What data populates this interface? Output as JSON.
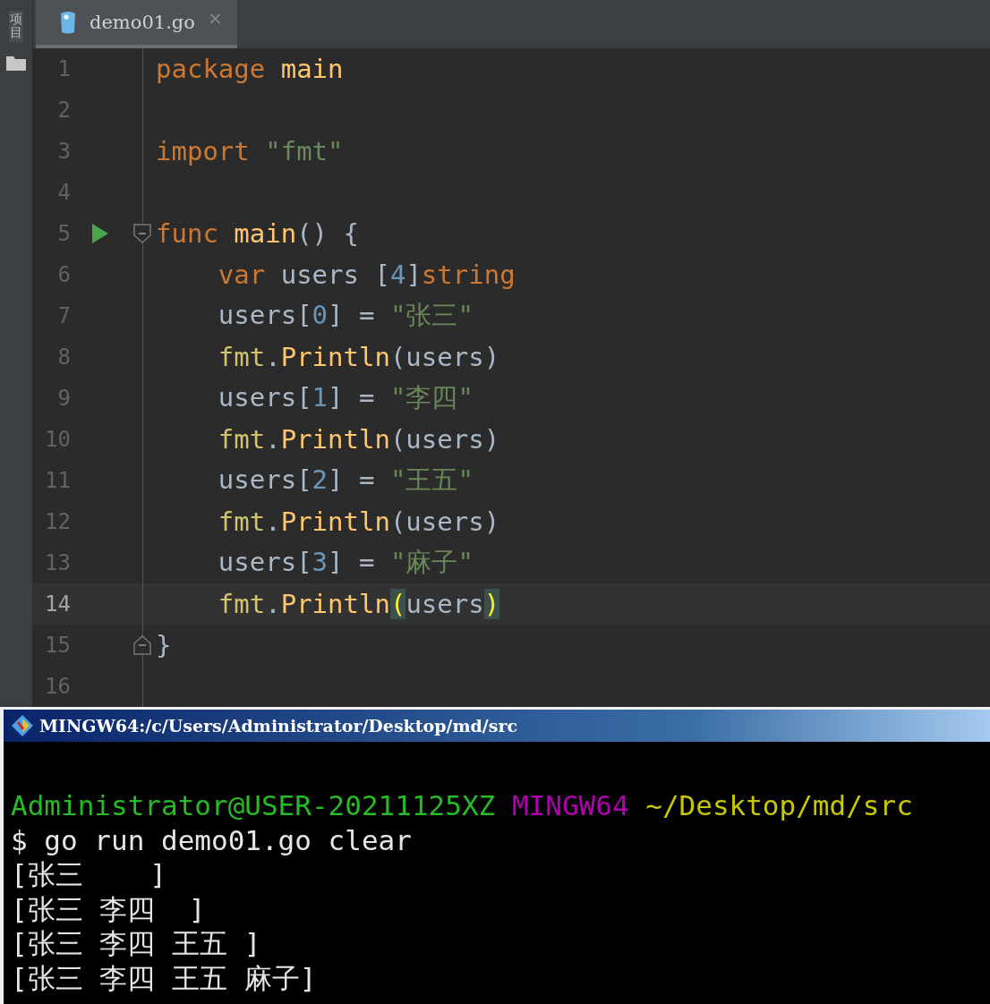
{
  "sidebar": {
    "label": "项目"
  },
  "tab": {
    "label": "demo01.go",
    "close": "×",
    "selected": true
  },
  "editor": {
    "lines": [
      {
        "number": "1",
        "current": false,
        "run": false,
        "tokens": [
          {
            "text": "package",
            "kind": "keyword"
          },
          {
            "text": " main",
            "kind": "func"
          }
        ]
      },
      {
        "number": "2",
        "current": false,
        "run": false
      },
      {
        "number": "3",
        "current": false,
        "run": false,
        "tokens": [
          {
            "text": "import",
            "kind": "keyword"
          },
          {
            "text": " \"fmt\"",
            "kind": "string"
          }
        ]
      },
      {
        "number": "4",
        "current": false,
        "run": false
      },
      {
        "number": "5",
        "current": false,
        "run": true,
        "fold_start": true,
        "tokens": [
          {
            "text": "func",
            "kind": "keyword"
          },
          {
            "text": " main",
            "kind": "func"
          },
          {
            "text": "() {",
            "kind": "plain"
          }
        ]
      },
      {
        "number": "6",
        "current": false,
        "run": false,
        "tokens": [
          {
            "text": "    var",
            "kind": "keyword"
          },
          {
            "text": " users [",
            "kind": "plain"
          },
          {
            "text": "4",
            "kind": "number"
          },
          {
            "text": "]",
            "kind": "plain"
          },
          {
            "text": "string",
            "kind": "keyword"
          }
        ]
      },
      {
        "number": "7",
        "current": false,
        "run": false,
        "tokens": [
          {
            "text": "    users[",
            "kind": "plain"
          },
          {
            "text": "0",
            "kind": "number"
          },
          {
            "text": "] = ",
            "kind": "plain"
          },
          {
            "text": "\"张三\"",
            "kind": "string"
          }
        ]
      },
      {
        "number": "8",
        "current": false,
        "run": false,
        "tokens": [
          {
            "text": "    fmt",
            "kind": "package"
          },
          {
            "text": ".",
            "kind": "plain"
          },
          {
            "text": "Println",
            "kind": "func"
          },
          {
            "text": "(users)",
            "kind": "plain"
          }
        ]
      },
      {
        "number": "9",
        "current": false,
        "run": false,
        "tokens": [
          {
            "text": "    users[",
            "kind": "plain"
          },
          {
            "text": "1",
            "kind": "number"
          },
          {
            "text": "] = ",
            "kind": "plain"
          },
          {
            "text": "\"李四\"",
            "kind": "string"
          }
        ]
      },
      {
        "number": "10",
        "current": false,
        "run": false,
        "tokens": [
          {
            "text": "    fmt",
            "kind": "package"
          },
          {
            "text": ".",
            "kind": "plain"
          },
          {
            "text": "Println",
            "kind": "func"
          },
          {
            "text": "(users)",
            "kind": "plain"
          }
        ]
      },
      {
        "number": "11",
        "current": false,
        "run": false,
        "tokens": [
          {
            "text": "    users[",
            "kind": "plain"
          },
          {
            "text": "2",
            "kind": "number"
          },
          {
            "text": "] = ",
            "kind": "plain"
          },
          {
            "text": "\"王五\"",
            "kind": "string"
          }
        ]
      },
      {
        "number": "12",
        "current": false,
        "run": false,
        "tokens": [
          {
            "text": "    fmt",
            "kind": "package"
          },
          {
            "text": ".",
            "kind": "plain"
          },
          {
            "text": "Println",
            "kind": "func"
          },
          {
            "text": "(users)",
            "kind": "plain"
          }
        ]
      },
      {
        "number": "13",
        "current": false,
        "run": false,
        "tokens": [
          {
            "text": "    users[",
            "kind": "plain"
          },
          {
            "text": "3",
            "kind": "number"
          },
          {
            "text": "] = ",
            "kind": "plain"
          },
          {
            "text": "\"麻子\"",
            "kind": "string"
          }
        ]
      },
      {
        "number": "14",
        "current": true,
        "run": false,
        "tokens": [
          {
            "text": "    fmt",
            "kind": "package"
          },
          {
            "text": ".",
            "kind": "plain"
          },
          {
            "text": "Println",
            "kind": "func"
          },
          {
            "text": "(",
            "kind": "match"
          },
          {
            "text": "users",
            "kind": "plain"
          },
          {
            "text": ")",
            "kind": "match"
          }
        ]
      },
      {
        "number": "15",
        "current": false,
        "run": false,
        "fold_end": true,
        "tokens": [
          {
            "text": "}",
            "kind": "plain"
          }
        ]
      },
      {
        "number": "16",
        "current": false,
        "run": false
      }
    ]
  },
  "terminal": {
    "title": "MINGW64:/c/Users/Administrator/Desktop/md/src",
    "lines": [
      [
        {
          "text": "Administrator@USER-20211125XZ",
          "kind": "user"
        },
        {
          "text": " MINGW64",
          "kind": "host"
        },
        {
          "text": " ~/Desktop/md/src",
          "kind": "path"
        }
      ],
      [
        {
          "text": "$ go run demo01.go clear",
          "kind": "out"
        }
      ],
      [
        {
          "text": "[张三    ]",
          "kind": "out"
        }
      ],
      [
        {
          "text": "[张三 李四  ]",
          "kind": "out"
        }
      ],
      [
        {
          "text": "[张三 李四 王五 ]",
          "kind": "out"
        }
      ],
      [
        {
          "text": "[张三 李四 王五 麻子]",
          "kind": "out"
        }
      ]
    ]
  }
}
